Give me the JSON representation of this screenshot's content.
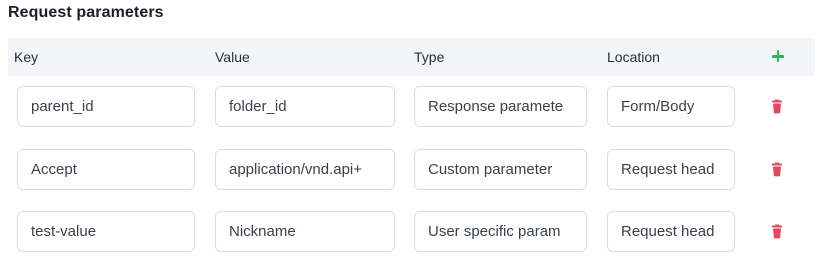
{
  "section": {
    "title": "Request parameters"
  },
  "table": {
    "headers": {
      "key": "Key",
      "value": "Value",
      "type": "Type",
      "location": "Location"
    },
    "add_icon": "plus-icon",
    "delete_icon": "trash-icon",
    "rows": [
      {
        "key": "parent_id",
        "value": "folder_id",
        "type": "Response paramete",
        "location": "Form/Body"
      },
      {
        "key": "Accept",
        "value": "application/vnd.api+",
        "type": "Custom parameter",
        "location": "Request head"
      },
      {
        "key": "test-value",
        "value": "Nickname",
        "type": "User specific param",
        "location": "Request head"
      }
    ]
  },
  "colors": {
    "add": "#2fb463",
    "delete": "#e8455f",
    "header_bg": "#f3f5f8",
    "field_border": "#d9dde3"
  }
}
